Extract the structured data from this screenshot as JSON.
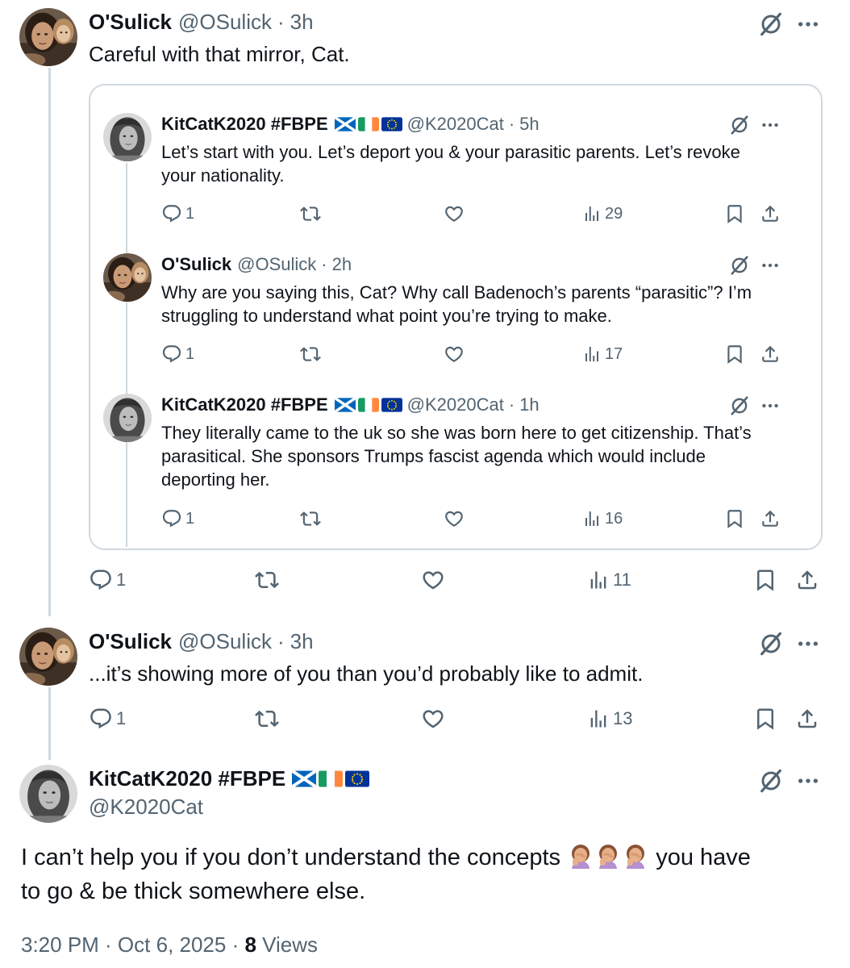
{
  "tweet_top": {
    "name": "O'Sulick",
    "handle": "@OSulick",
    "time": "3h",
    "text": "Careful with that mirror, Cat.",
    "stats": {
      "replies": "1",
      "views": "11"
    }
  },
  "quote_tweets": [
    {
      "name": "KitCatK2020 #FBPE",
      "handle": "@K2020Cat",
      "time": "5h",
      "line1": "Let’s start with you. Let’s deport you & your parasitic parents. Let’s revoke",
      "line2": "your nationality.",
      "line3": "",
      "replies": "1",
      "views": "29"
    },
    {
      "name": "O'Sulick",
      "handle": "@OSulick",
      "time": "2h",
      "line1": "Why are you saying this, Cat? Why call Badenoch’s parents “parasitic”? I’m",
      "line2": "struggling to understand what point you’re trying to make.",
      "line3": "",
      "replies": "1",
      "views": "17"
    },
    {
      "name": "KitCatK2020 #FBPE",
      "handle": "@K2020Cat",
      "time": "1h",
      "line1": "They literally came to the uk so she was born here to get citizenship. That’s",
      "line2": "parasitical. She sponsors Trumps fascist agenda which would include",
      "line3": "deporting her.",
      "replies": "1",
      "views": "16"
    }
  ],
  "tweet_second": {
    "name": "O'Sulick",
    "handle": "@OSulick",
    "time": "3h",
    "text": "...it’s showing more of you than you’d probably like to admit.",
    "stats": {
      "replies": "1",
      "views": "13"
    }
  },
  "main_tweet": {
    "name": "KitCatK2020 #FBPE",
    "handle": "@K2020Cat",
    "text_part1": "I can’t help you if you don’t understand the concepts",
    "text_part2": "you have",
    "text_part3": "to go & be thick somewhere else.",
    "timestamp": "3:20 PM · Oct 6, 2025 · ",
    "views_count": "8",
    "views_label": " Views"
  },
  "separator_dot": "·",
  "icons": {
    "grok": "grok-icon",
    "more": "more-icon",
    "reply": "reply-icon",
    "retweet": "retweet-icon",
    "like": "heart-icon",
    "views": "views-icon",
    "bookmark": "bookmark-icon",
    "share": "share-icon"
  },
  "flags": [
    "scotland-flag",
    "ireland-flag",
    "eu-flag"
  ],
  "colors": {
    "text": "#0f1419",
    "secondary": "#536471",
    "border": "#cfd9de"
  }
}
